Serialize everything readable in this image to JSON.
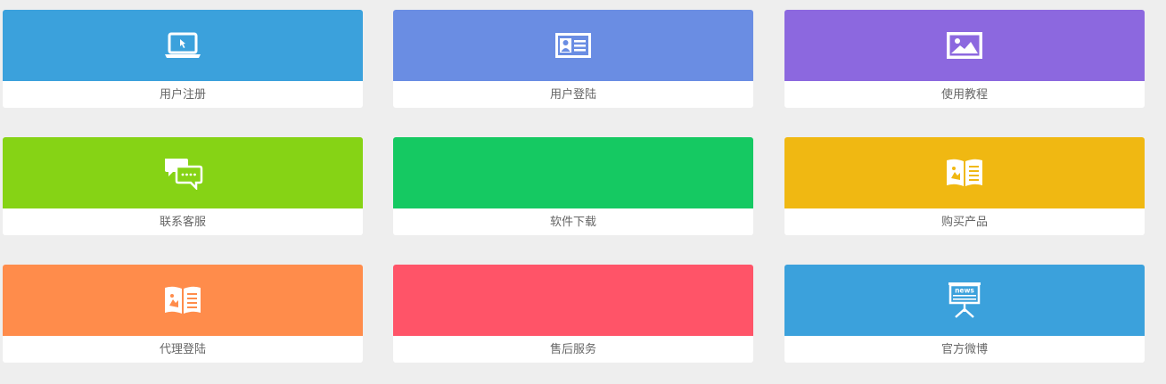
{
  "tiles": [
    {
      "label": "用户注册",
      "color": "#3ba1dc",
      "icon": "laptop-icon"
    },
    {
      "label": "用户登陆",
      "color": "#6a8de3",
      "icon": "id-card-icon"
    },
    {
      "label": "使用教程",
      "color": "#8c68df",
      "icon": "picture-icon"
    },
    {
      "label": "联系客服",
      "color": "#86d315",
      "icon": "chat-bubbles-icon"
    },
    {
      "label": "软件下载",
      "color": "#15c962",
      "icon": ""
    },
    {
      "label": "购买产品",
      "color": "#f0b812",
      "icon": "open-book-icon"
    },
    {
      "label": "代理登陆",
      "color": "#ff8c4b",
      "icon": "open-book-icon"
    },
    {
      "label": "售后服务",
      "color": "#ff5468",
      "icon": ""
    },
    {
      "label": "官方微博",
      "color": "#3ba1dc",
      "icon": "news-board-icon",
      "icon_text": "news"
    }
  ]
}
